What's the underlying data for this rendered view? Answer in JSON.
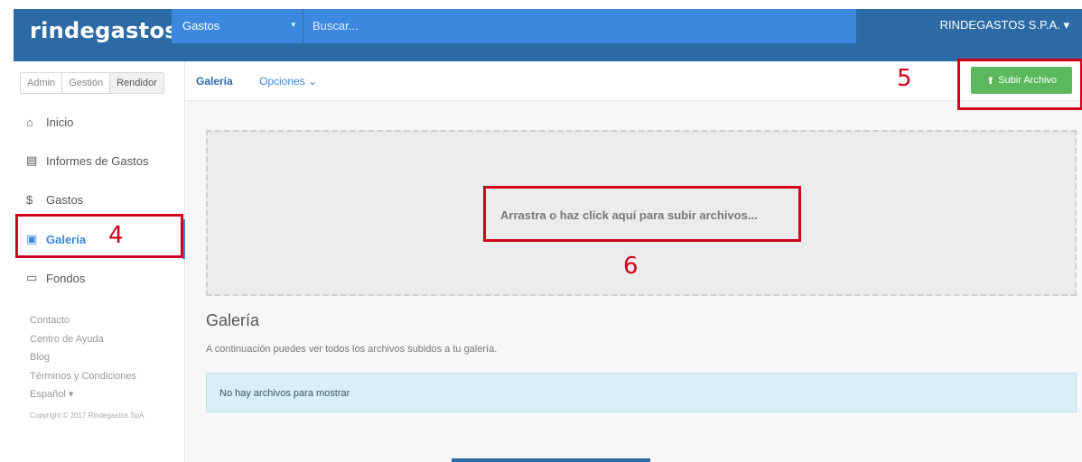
{
  "brand": {
    "name": "rindegastos",
    "dot_color": "#6cc04a"
  },
  "topbar": {
    "select_value": "Gastos",
    "select_caret": "▾",
    "search_placeholder": "Buscar...",
    "company": "RINDEGASTOS S.P.A.",
    "company_caret": "▾",
    "color": "#2c6aa6"
  },
  "sidebar": {
    "roles": [
      "Admin",
      "Gestión",
      "Rendidor"
    ],
    "items": [
      {
        "label": "Inicio",
        "icon": "home-icon",
        "glyph": "⌂"
      },
      {
        "label": "Informes de Gastos",
        "icon": "document-icon",
        "glyph": "▤"
      },
      {
        "label": "Gastos",
        "icon": "dollar-icon",
        "glyph": "$"
      },
      {
        "label": "Galería",
        "icon": "picture-icon",
        "glyph": "▣",
        "active": true
      },
      {
        "label": "Fondos",
        "icon": "card-icon",
        "glyph": "▭"
      }
    ],
    "footer": [
      "Contacto",
      "Centro de Ayuda",
      "Blog",
      "Términos y Condiciones",
      "Español ▾"
    ],
    "copyright": "Copyright © 2017 Rindegastos SpA"
  },
  "subnav": {
    "active_tab": "Galería",
    "options_tab": "Opciones",
    "options_caret": "⌄"
  },
  "upload": {
    "label": "Subir Archivo",
    "icon": "upload-icon",
    "glyph": "⬆",
    "color": "#5cb85c"
  },
  "dropzone": {
    "text": "Arrastra o haz click aquí para subir archivos..."
  },
  "gallery": {
    "title": "Galería",
    "description": "A continuación puedes ver todos los archivos subidos a tu galería.",
    "empty_message": "No hay archivos para mostrar"
  },
  "annotations": [
    {
      "number": "4"
    },
    {
      "number": "5"
    },
    {
      "number": "6"
    }
  ]
}
